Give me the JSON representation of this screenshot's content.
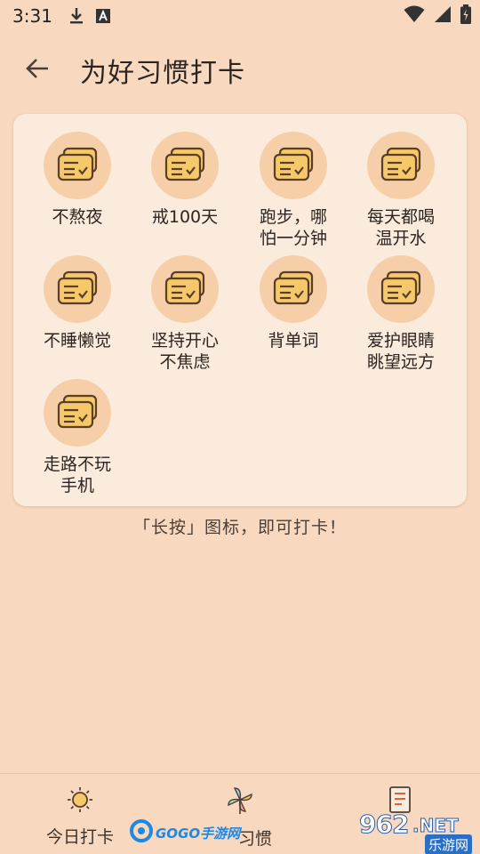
{
  "status_bar": {
    "time": "3:31",
    "icons_left": [
      "download-icon",
      "a-box-icon"
    ],
    "icons_right": [
      "wifi-icon",
      "signal-icon",
      "battery-charging-icon"
    ]
  },
  "app_bar": {
    "title": "为好习惯打卡",
    "back_icon": "arrow-left-icon"
  },
  "habits": [
    {
      "label": "不熬夜"
    },
    {
      "label": "戒100天"
    },
    {
      "label": "跑步，哪怕一分钟"
    },
    {
      "label": "每天都喝温开水"
    },
    {
      "label": "不睡懒觉"
    },
    {
      "label": "坚持开心不焦虑"
    },
    {
      "label": "背单词"
    },
    {
      "label": "爱护眼睛眺望远方"
    },
    {
      "label": "走路不玩手机"
    }
  ],
  "hint": "「长按」图标，即可打卡！",
  "bottom_nav": [
    {
      "label": "今日打卡",
      "icon": "sun-icon"
    },
    {
      "label": "习惯",
      "icon": "pinwheel-icon"
    },
    {
      "label": "",
      "icon": "notebook-icon"
    }
  ],
  "watermarks": {
    "left": "GOGO手游网",
    "right_number": "962",
    "right_suffix": ".NET",
    "right_cn": "乐游网"
  },
  "colors": {
    "background": "#F8D8BE",
    "card": "#FBEBDD",
    "icon_circle": "#F6CFA8",
    "icon_fill": "#F5C96A",
    "icon_stroke": "#5A3E2B"
  }
}
